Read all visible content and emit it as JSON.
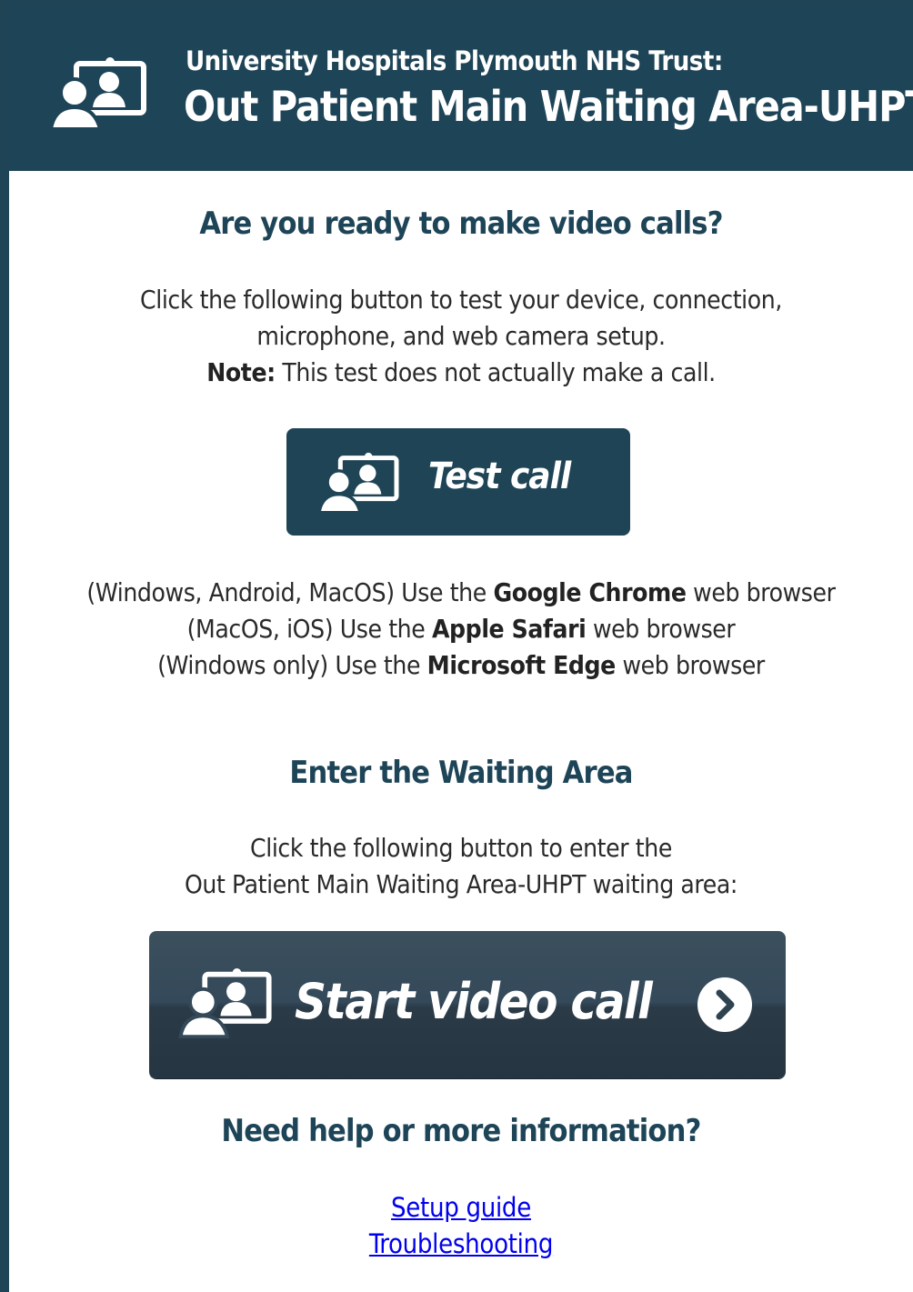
{
  "colors": {
    "brand": "#1e4457",
    "button_dark": "#2f4250",
    "link": "#0000ee"
  },
  "header": {
    "organisation": "University Hospitals Plymouth NHS Trust:",
    "waiting_area": "Out Patient Main Waiting Area-UHPT",
    "icon": "video-call-icon"
  },
  "test_section": {
    "heading": "Are you ready to make video calls?",
    "intro_line1": "Click the following button to test your device, connection,",
    "intro_line2": "microphone, and web camera setup.",
    "note_label": "Note:",
    "note_text": " This test does not actually make a call.",
    "button_label": "Test call",
    "browsers": [
      {
        "prefix": "(Windows, Android, MacOS) Use the ",
        "browser": "Google Chrome",
        "suffix": " web browser"
      },
      {
        "prefix": "(MacOS, iOS) Use the ",
        "browser": "Apple Safari",
        "suffix": " web browser"
      },
      {
        "prefix": "(Windows only) Use the ",
        "browser": "Microsoft Edge",
        "suffix": " web browser"
      }
    ]
  },
  "enter_section": {
    "heading": "Enter the Waiting Area",
    "intro_line1": "Click the following button to enter the",
    "intro_line2": "Out Patient Main Waiting Area-UHPT waiting area:",
    "button_label": "Start video call",
    "button_icon": "chevron-right-circle-icon"
  },
  "help_section": {
    "heading": "Need help or more information?",
    "links": [
      "Setup guide",
      "Troubleshooting"
    ]
  }
}
